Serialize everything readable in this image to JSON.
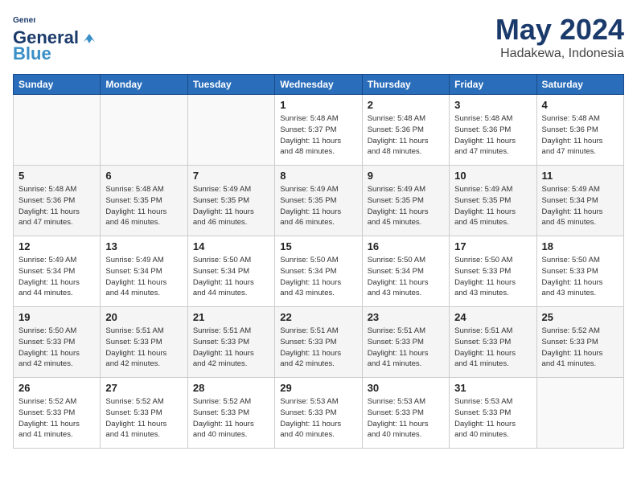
{
  "logo": {
    "line1": "General",
    "line2": "Blue"
  },
  "title": "May 2024",
  "subtitle": "Hadakewa, Indonesia",
  "weekdays": [
    "Sunday",
    "Monday",
    "Tuesday",
    "Wednesday",
    "Thursday",
    "Friday",
    "Saturday"
  ],
  "weeks": [
    [
      {
        "day": "",
        "info": ""
      },
      {
        "day": "",
        "info": ""
      },
      {
        "day": "",
        "info": ""
      },
      {
        "day": "1",
        "info": "Sunrise: 5:48 AM\nSunset: 5:37 PM\nDaylight: 11 hours\nand 48 minutes."
      },
      {
        "day": "2",
        "info": "Sunrise: 5:48 AM\nSunset: 5:36 PM\nDaylight: 11 hours\nand 48 minutes."
      },
      {
        "day": "3",
        "info": "Sunrise: 5:48 AM\nSunset: 5:36 PM\nDaylight: 11 hours\nand 47 minutes."
      },
      {
        "day": "4",
        "info": "Sunrise: 5:48 AM\nSunset: 5:36 PM\nDaylight: 11 hours\nand 47 minutes."
      }
    ],
    [
      {
        "day": "5",
        "info": "Sunrise: 5:48 AM\nSunset: 5:36 PM\nDaylight: 11 hours\nand 47 minutes."
      },
      {
        "day": "6",
        "info": "Sunrise: 5:48 AM\nSunset: 5:35 PM\nDaylight: 11 hours\nand 46 minutes."
      },
      {
        "day": "7",
        "info": "Sunrise: 5:49 AM\nSunset: 5:35 PM\nDaylight: 11 hours\nand 46 minutes."
      },
      {
        "day": "8",
        "info": "Sunrise: 5:49 AM\nSunset: 5:35 PM\nDaylight: 11 hours\nand 46 minutes."
      },
      {
        "day": "9",
        "info": "Sunrise: 5:49 AM\nSunset: 5:35 PM\nDaylight: 11 hours\nand 45 minutes."
      },
      {
        "day": "10",
        "info": "Sunrise: 5:49 AM\nSunset: 5:35 PM\nDaylight: 11 hours\nand 45 minutes."
      },
      {
        "day": "11",
        "info": "Sunrise: 5:49 AM\nSunset: 5:34 PM\nDaylight: 11 hours\nand 45 minutes."
      }
    ],
    [
      {
        "day": "12",
        "info": "Sunrise: 5:49 AM\nSunset: 5:34 PM\nDaylight: 11 hours\nand 44 minutes."
      },
      {
        "day": "13",
        "info": "Sunrise: 5:49 AM\nSunset: 5:34 PM\nDaylight: 11 hours\nand 44 minutes."
      },
      {
        "day": "14",
        "info": "Sunrise: 5:50 AM\nSunset: 5:34 PM\nDaylight: 11 hours\nand 44 minutes."
      },
      {
        "day": "15",
        "info": "Sunrise: 5:50 AM\nSunset: 5:34 PM\nDaylight: 11 hours\nand 43 minutes."
      },
      {
        "day": "16",
        "info": "Sunrise: 5:50 AM\nSunset: 5:34 PM\nDaylight: 11 hours\nand 43 minutes."
      },
      {
        "day": "17",
        "info": "Sunrise: 5:50 AM\nSunset: 5:33 PM\nDaylight: 11 hours\nand 43 minutes."
      },
      {
        "day": "18",
        "info": "Sunrise: 5:50 AM\nSunset: 5:33 PM\nDaylight: 11 hours\nand 43 minutes."
      }
    ],
    [
      {
        "day": "19",
        "info": "Sunrise: 5:50 AM\nSunset: 5:33 PM\nDaylight: 11 hours\nand 42 minutes."
      },
      {
        "day": "20",
        "info": "Sunrise: 5:51 AM\nSunset: 5:33 PM\nDaylight: 11 hours\nand 42 minutes."
      },
      {
        "day": "21",
        "info": "Sunrise: 5:51 AM\nSunset: 5:33 PM\nDaylight: 11 hours\nand 42 minutes."
      },
      {
        "day": "22",
        "info": "Sunrise: 5:51 AM\nSunset: 5:33 PM\nDaylight: 11 hours\nand 42 minutes."
      },
      {
        "day": "23",
        "info": "Sunrise: 5:51 AM\nSunset: 5:33 PM\nDaylight: 11 hours\nand 41 minutes."
      },
      {
        "day": "24",
        "info": "Sunrise: 5:51 AM\nSunset: 5:33 PM\nDaylight: 11 hours\nand 41 minutes."
      },
      {
        "day": "25",
        "info": "Sunrise: 5:52 AM\nSunset: 5:33 PM\nDaylight: 11 hours\nand 41 minutes."
      }
    ],
    [
      {
        "day": "26",
        "info": "Sunrise: 5:52 AM\nSunset: 5:33 PM\nDaylight: 11 hours\nand 41 minutes."
      },
      {
        "day": "27",
        "info": "Sunrise: 5:52 AM\nSunset: 5:33 PM\nDaylight: 11 hours\nand 41 minutes."
      },
      {
        "day": "28",
        "info": "Sunrise: 5:52 AM\nSunset: 5:33 PM\nDaylight: 11 hours\nand 40 minutes."
      },
      {
        "day": "29",
        "info": "Sunrise: 5:53 AM\nSunset: 5:33 PM\nDaylight: 11 hours\nand 40 minutes."
      },
      {
        "day": "30",
        "info": "Sunrise: 5:53 AM\nSunset: 5:33 PM\nDaylight: 11 hours\nand 40 minutes."
      },
      {
        "day": "31",
        "info": "Sunrise: 5:53 AM\nSunset: 5:33 PM\nDaylight: 11 hours\nand 40 minutes."
      },
      {
        "day": "",
        "info": ""
      }
    ]
  ]
}
